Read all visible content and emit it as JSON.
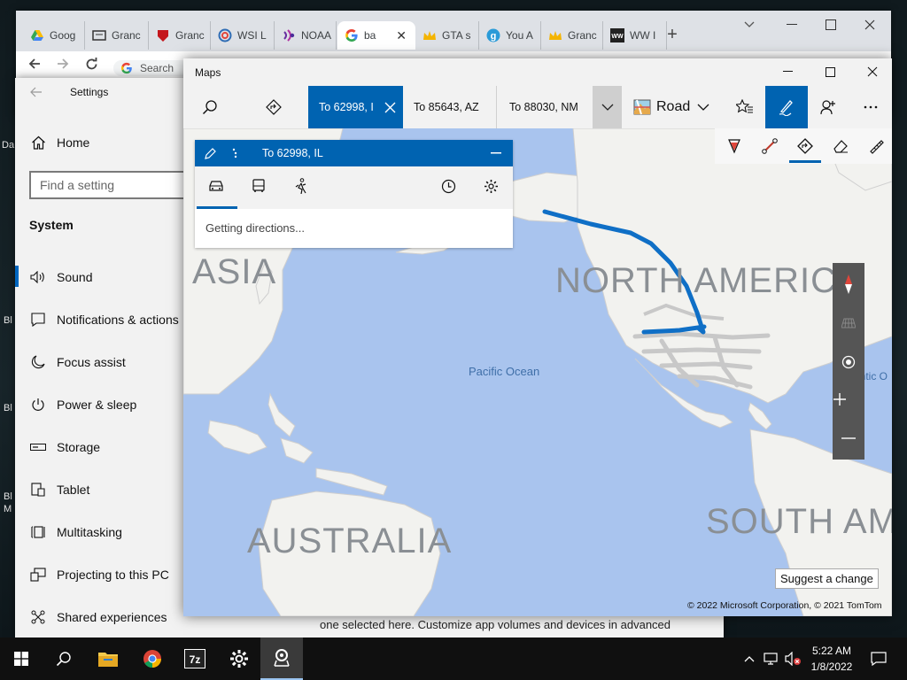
{
  "desktop": {
    "icon_labels": [
      "Da",
      "Bl",
      "Bl",
      "Bl",
      "M"
    ]
  },
  "chrome": {
    "tabs": [
      {
        "label": "Goog",
        "icon": "google-drive-icon"
      },
      {
        "label": "Granc",
        "icon": "page-icon"
      },
      {
        "label": "Granc",
        "icon": "red-shield-icon"
      },
      {
        "label": "WSI L",
        "icon": "spiral-icon"
      },
      {
        "label": "NOAA",
        "icon": "noaa-icon"
      },
      {
        "label": "ba",
        "icon": "google-g-icon",
        "active": true
      },
      {
        "label": "GTA s",
        "icon": "crown-icon"
      },
      {
        "label": "You A",
        "icon": "g-circle-icon"
      },
      {
        "label": "Granc",
        "icon": "crown-icon"
      },
      {
        "label": "WW I",
        "icon": "ww-icon"
      }
    ],
    "new_tab": "+",
    "address_hint": "Search"
  },
  "settings": {
    "title": "Settings",
    "home": "Home",
    "search_placeholder": "Find a setting",
    "section": "System",
    "items": [
      "Sound",
      "Notifications & actions",
      "Focus assist",
      "Power & sleep",
      "Storage",
      "Tablet",
      "Multitasking",
      "Projecting to this PC",
      "Shared experiences"
    ],
    "bottom_text": "one selected here. Customize app volumes and devices in advanced"
  },
  "maps": {
    "title": "Maps",
    "tabs": [
      "To 62998, I",
      "To 85643, AZ",
      "To 88030, NM"
    ],
    "style": "Road",
    "directions": {
      "header": "To 62998, IL",
      "status": "Getting directions..."
    },
    "map_labels": {
      "asia": "ASIA",
      "north_america": "NORTH AMERICA",
      "south_america": "SOUTH AM",
      "australia": "AUSTRALIA",
      "pacific": "Pacific Ocean",
      "atlantic": "Atlantic O"
    },
    "suggest": "Suggest a change",
    "copyright": "© 2022 Microsoft Corporation, © 2021 TomTom",
    "ink_color": "#0f6fc6"
  },
  "taskbar": {
    "time": "5:22 AM",
    "date": "1/8/2022"
  }
}
